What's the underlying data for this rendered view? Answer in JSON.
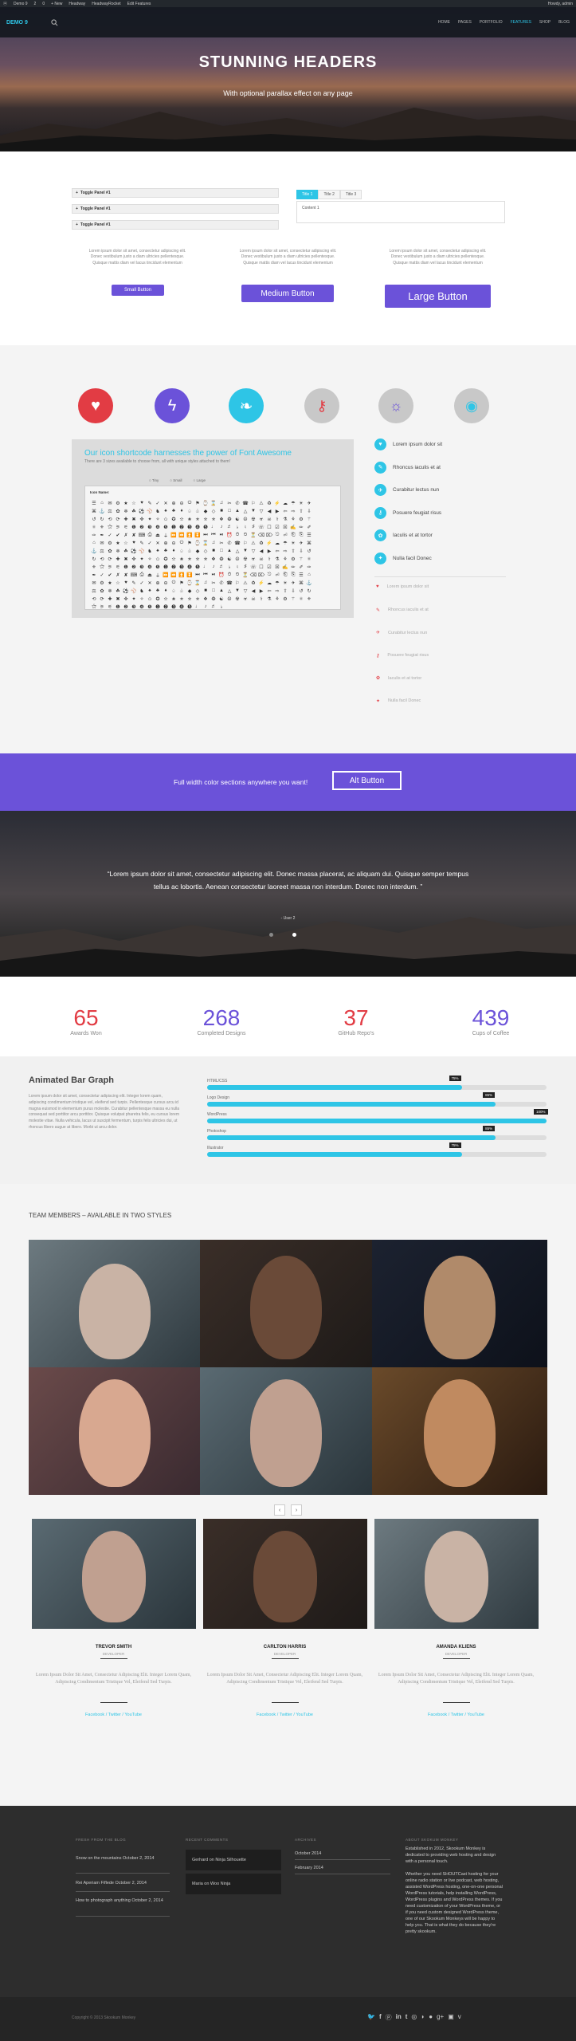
{
  "adminbar": {
    "items": [
      "Demo 9",
      "2",
      "0",
      "+ New",
      "Headway",
      "HeadwayRocket",
      "Edit Features"
    ],
    "user": "Howdy, admin"
  },
  "nav": {
    "logo": "DEMO 9",
    "menu": [
      "HOME",
      "PAGES",
      "PORTFOLIO",
      "FEATURES",
      "SHOP",
      "BLOG"
    ],
    "active_index": 3
  },
  "hero": {
    "title": "STUNNING HEADERS",
    "subtitle": "With optional parallax effect on any page"
  },
  "toggles": [
    "Toggle Panel #1",
    "Toggle Panel #1",
    "Toggle Panel #1"
  ],
  "tabs": {
    "labels": [
      "Title 1",
      "Title 2",
      "Title 3"
    ],
    "content": "Content 1"
  },
  "lorem_cols": [
    "Lorem ipsum dolor sit amet, consectetur adipiscing elit. Donec vestibulum justo a diam ultricies pellentesque. Quisque mattis diam vel lacus tincidunt elementum",
    "Lorem ipsum dolor sit amet, consectetur adipiscing elit. Donec vestibulum justo a diam ultricies pellentesque. Quisque mattis diam vel lacus tincidunt elementum",
    "Lorem ipsum dolor sit amet, consectetur adipiscing elit. Donec vestibulum justo a diam ultricies pellentesque. Quisque mattis diam vel lacus tincidunt elementum"
  ],
  "buttons": {
    "small": "Small Button",
    "medium": "Medium Button",
    "large": "Large Button"
  },
  "icon_circles": [
    {
      "icon": "heart-icon",
      "glyph": "♥",
      "color": "#e23c44"
    },
    {
      "icon": "bolt-icon",
      "glyph": "ϟ",
      "color": "#6b52d9"
    },
    {
      "icon": "leaf-icon",
      "glyph": "❧",
      "color": "#2ec5e6"
    },
    {
      "icon": "key-icon",
      "glyph": "⚷",
      "color": "#c8c8c8"
    },
    {
      "icon": "bulb-icon",
      "glyph": "☼",
      "color": "#c8c8c8"
    },
    {
      "icon": "eye-icon",
      "glyph": "◉",
      "color": "#c8c8c8"
    }
  ],
  "iconpanel": {
    "title": "Our icon shortcode harnesses the power of Font Awesome",
    "subtitle": "There are 3 sizes available to choose from, all with unique styles attached to them!",
    "label": "Icon Name:",
    "sizes": [
      "Tiny",
      "Small",
      "Large"
    ]
  },
  "list_a": [
    "Lorem ipsum dolor sit",
    "Rhoncus iaculis et at",
    "Curabitur lectus nun",
    "Posuere feugiat risus",
    "Iaculis et at tortor",
    "Nulla facil Donec"
  ],
  "list_b": [
    "Lorem ipsum dolor sit",
    "Rhoncus iaculis et at",
    "Curabitur lectus nun",
    "Posuere feugiat risus",
    "Iaculis et at tortor",
    "Nulla facil Donec"
  ],
  "purple": {
    "text": "Full width color sections anywhere you want!",
    "button": "Alt Button"
  },
  "testimonial": {
    "quote": "“Lorem ipsum dolor sit amet, consectetur adipiscing elit. Donec massa placerat, ac aliquam dui. Quisque semper tempus tellus ac lobortis. Aenean consectetur laoreet massa non interdum. Donec non interdum. ”",
    "author": "- User 2"
  },
  "counters": [
    {
      "value": "65",
      "label": "Awards Won",
      "color": "#e23c44"
    },
    {
      "value": "268",
      "label": "Completed Designs",
      "color": "#6b52d9"
    },
    {
      "value": "37",
      "label": "GitHub Repo's",
      "color": "#e23c44"
    },
    {
      "value": "439",
      "label": "Cups of Coffee",
      "color": "#6b52d9"
    }
  ],
  "bargraph": {
    "title": "Animated Bar Graph",
    "description": "Lorem ipsum dolor sit amet, consectetur adipiscing elit. Integer lorem quam, adipiscing condimentum tristique vel, eleifend sed turpis. Pellentesque cursus arcu id magna euismod in elementum purus molestie. Curabitur pellentesque massa eu nulla consequat sed porttitor arcu porttitor. Quisque volutpat pharetra felis, eu cursus lorem molestie vitae. Nulla vehicula, lacus ut suscipit fermentum, turpis felis ultricies dui, ut rhoncus libero augue at libero. Morbi ut arcu dolor.",
    "bars": [
      {
        "label": "HTML/CSS",
        "value": 75,
        "tip": "75%"
      },
      {
        "label": "Logo Design",
        "value": 85,
        "tip": "85%"
      },
      {
        "label": "WordPress",
        "value": 100,
        "tip": "100%"
      },
      {
        "label": "Photoshop",
        "value": 85,
        "tip": "85%"
      },
      {
        "label": "Illustrator",
        "value": 75,
        "tip": "75%"
      }
    ]
  },
  "team": {
    "heading": "TEAM MEMBERS – AVAILABLE IN TWO STYLES",
    "nav": [
      "‹",
      "›"
    ],
    "members": [
      {
        "name": "TREVOR SMITH",
        "role": "DEVELOPER",
        "desc": "Lorem Ipsum Dolor Sit Amet, Consectetur Adipiscing Elit. Integer Lorem Quam, Adipiscing Condimentum Tristique Vel, Eleifend Sed Turpis.",
        "links": "Facebook / Twitter / YouTube"
      },
      {
        "name": "CARLTON HARRIS",
        "role": "DEVELOPER",
        "desc": "Lorem Ipsum Dolor Sit Amet, Consectetur Adipiscing Elit. Integer Lorem Quam, Adipiscing Condimentum Tristique Vel, Eleifend Sed Turpis.",
        "links": "Facebook / Twitter / YouTube"
      },
      {
        "name": "AMANDA KLIENS",
        "role": "DEVELOPER",
        "desc": "Lorem Ipsum Dolor Sit Amet, Consectetur Adipiscing Elit. Integer Lorem Quam, Adipiscing Condimentum Tristique Vel, Eleifend Sed Turpis.",
        "links": "Facebook / Twitter / YouTube"
      }
    ]
  },
  "footer": {
    "headings": [
      "FRESH FROM THE BLOG",
      "RECENT COMMENTS",
      "ARCHIVES",
      "ABOUT SKOKUM MONKEY"
    ],
    "blog": [
      "Snow on the mountains October 2, 2014",
      "Rei Aperiam Fiflede October 2, 2014",
      "How to photograph anything October 2, 2014"
    ],
    "comments": [
      "Gerhard on Ninja Silhouette",
      "Maria on Woo Ninja"
    ],
    "archives": [
      "October 2014",
      "February 2014"
    ],
    "about": "Established in 2012, Skookum Monkey is dedicated to providing web hosting and design with a personal touch.\n\nWhether you need SHOUTCast hosting for your online radio station or live podcast, web hosting, assisted WordPress hosting, one-on-one personal WordPress tutorials, help installing WordPress, WordPress plugins and WordPress themes. If you need customization of your WordPress theme, or if you need custom designed WordPress theme, one of our Skookum Monkeys will be happy to help you. That is what they do because they're pretty skookum.",
    "copyright": "Copyright © 2013 Skookum Monkey"
  },
  "social": [
    "twitter-icon",
    "facebook-icon",
    "pinterest-icon",
    "linkedin-icon",
    "tumblr-icon",
    "dribbble-icon",
    "rss-icon",
    "flickr-icon",
    "googleplus-icon",
    "instagram-icon",
    "vimeo-icon"
  ]
}
